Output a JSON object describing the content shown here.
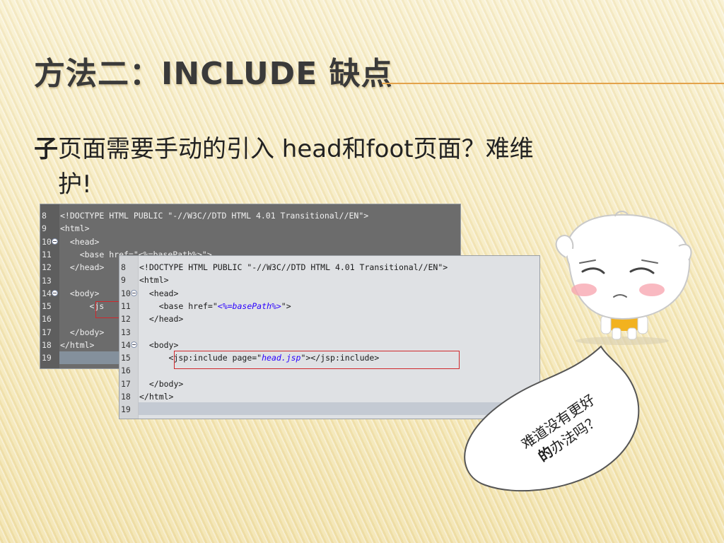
{
  "slide": {
    "title": "方法二：INCLUDE  缺点",
    "bullet": {
      "mark": "子",
      "line1": "页面需要手动的引入 head和foot页面？难维",
      "line2": "护!"
    }
  },
  "back_panel": {
    "rows": [
      {
        "num": "8",
        "text": "<!DOCTYPE HTML PUBLIC \"-//W3C//DTD HTML 4.01 Transitional//EN\">"
      },
      {
        "num": "9",
        "text": "<html>"
      },
      {
        "num": "10",
        "text": "  <head>"
      },
      {
        "num": "11",
        "text": "    <base href=\"<%=basePath%>\">"
      },
      {
        "num": "12",
        "text": "  </head>"
      },
      {
        "num": "13",
        "text": ""
      },
      {
        "num": "14",
        "text": "  <body>"
      },
      {
        "num": "15",
        "text": "      <js"
      },
      {
        "num": "16",
        "text": ""
      },
      {
        "num": "17",
        "text": "  </body>"
      },
      {
        "num": "18",
        "text": "</html>"
      },
      {
        "num": "19",
        "text": ""
      }
    ]
  },
  "front_panel": {
    "rows": [
      {
        "num": "8",
        "text": "<!DOCTYPE HTML PUBLIC \"-//W3C//DTD HTML 4.01 Transitional//EN\">"
      },
      {
        "num": "9",
        "text": "<html>"
      },
      {
        "num": "10",
        "text": "  <head>"
      },
      {
        "num": "11",
        "pre": "    <base href=\"",
        "val": "<%=basePath%>",
        "post": "\">"
      },
      {
        "num": "12",
        "text": "  </head>"
      },
      {
        "num": "13",
        "text": ""
      },
      {
        "num": "14",
        "text": "  <body>"
      },
      {
        "num": "15",
        "pre": "      <jsp:include page=\"",
        "val": "head.jsp",
        "post": "\"></jsp:include>"
      },
      {
        "num": "16",
        "text": ""
      },
      {
        "num": "17",
        "text": "  </body>"
      },
      {
        "num": "18",
        "text": "</html>"
      },
      {
        "num": "19",
        "text": ""
      }
    ]
  },
  "speech_bubble": {
    "line1": "难道没有更好",
    "line2_strong": "的",
    "line2_rest": "办法吗？"
  },
  "colors": {
    "title_rule": "#e3a24a",
    "highlight_box": "#d0282c"
  }
}
